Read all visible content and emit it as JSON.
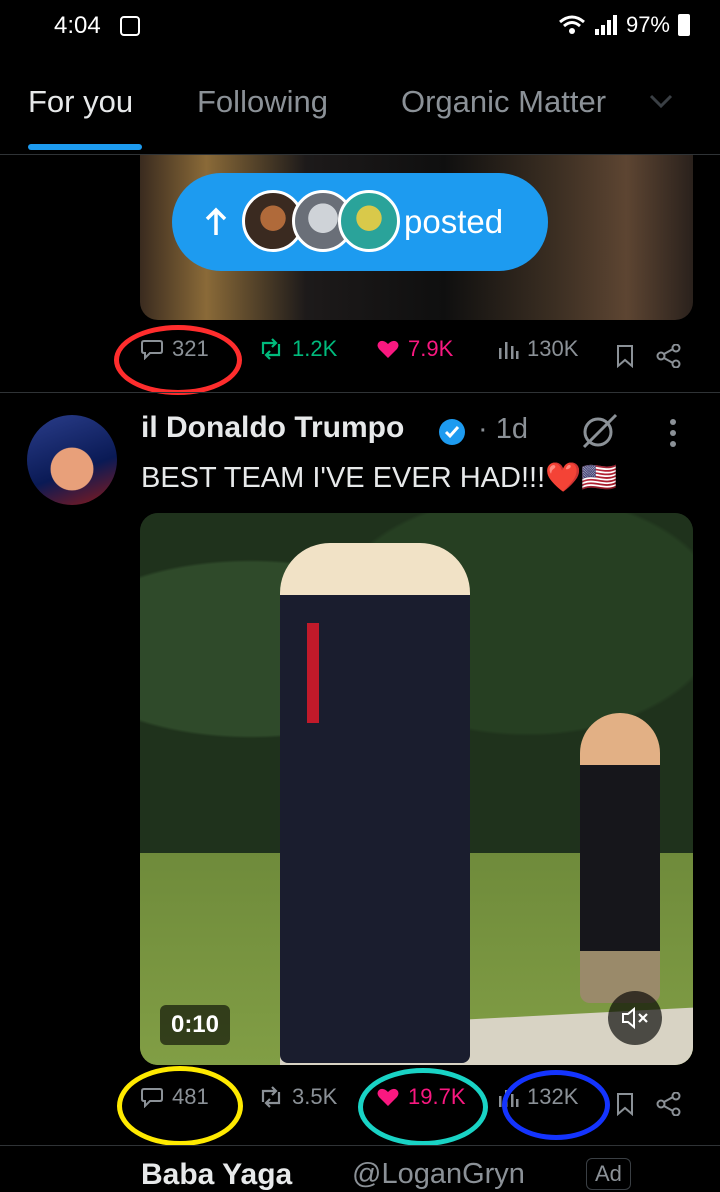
{
  "status_bar": {
    "time": "4:04",
    "battery": "97%"
  },
  "tabs": [
    {
      "label": "For you",
      "active": true
    },
    {
      "label": "Following",
      "active": false
    },
    {
      "label": "Organic Matter",
      "active": false
    }
  ],
  "previous_post": {
    "posted_pill_label": "posted",
    "stats": {
      "replies": "321",
      "reposts": "1.2K",
      "likes": "7.9K",
      "views": "130K"
    }
  },
  "tweet": {
    "author_name": "il Donaldo Trumpo",
    "time": "1d",
    "text": "BEST TEAM I'VE EVER HAD!!!❤️🇺🇸",
    "video_duration": "0:10",
    "stats": {
      "replies": "481",
      "reposts": "3.5K",
      "likes": "19.7K",
      "views": "132K"
    }
  },
  "next_tweet": {
    "author_name": "Baba Yaga",
    "handle": "@LoganGryn",
    "badge": "Ad"
  },
  "colors": {
    "accent": "#1d9bf0",
    "repost": "#00ba7c",
    "like": "#f91880",
    "annotation_red": "#ff2d2d",
    "annotation_yellow": "#ffea00",
    "annotation_teal": "#19d3c5",
    "annotation_blue": "#1434ff"
  }
}
